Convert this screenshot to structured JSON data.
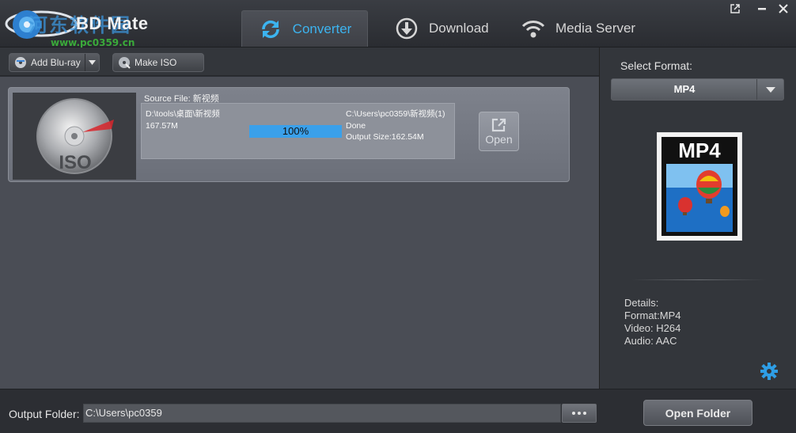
{
  "app": {
    "name": "BD Mate",
    "watermark": "河东软件园",
    "watermark_url": "www.pc0359.cn"
  },
  "tabs": [
    {
      "label": "Converter",
      "icon": "refresh-icon",
      "active": true
    },
    {
      "label": "Download",
      "icon": "download-icon",
      "active": false
    },
    {
      "label": "Media Server",
      "icon": "wifi-icon",
      "active": false
    }
  ],
  "window_controls": {
    "popout": "popout-icon",
    "minimize": "minimize-icon",
    "close": "close-icon"
  },
  "toolbar": {
    "add_bluray": "Add Blu-ray",
    "make_iso": "Make ISO"
  },
  "task": {
    "source_label": "Source File:",
    "source_name": "新视频",
    "thumb_label": "ISO",
    "input_path": "D:\\tools\\桌面\\新视频",
    "input_size": "167.57M",
    "progress_percent": 100,
    "progress_text": "100%",
    "output_path": "C:\\Users\\pc0359\\新视频(1)",
    "status": "Done",
    "output_size": "Output Size:162.54M",
    "open_label": "Open"
  },
  "format_panel": {
    "label": "Select Format:",
    "selected": "MP4",
    "image_label": "MP4",
    "details": [
      "Details:",
      "Format:MP4",
      "Video: H264",
      "Audio: AAC"
    ]
  },
  "bottom": {
    "output_label": "Output Folder:",
    "output_path": "C:\\Users\\pc0359",
    "open_folder": "Open Folder"
  },
  "colors": {
    "accent": "#3cb4f0",
    "progress": "#3aa0ea",
    "gear": "#2e9ee6"
  }
}
